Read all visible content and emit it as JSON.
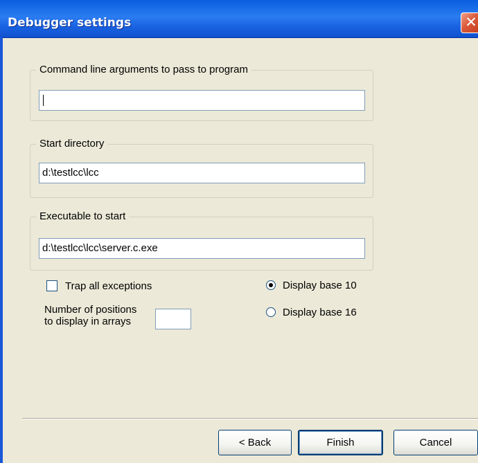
{
  "window": {
    "title": "Debugger settings",
    "close_glyph": "✕"
  },
  "groups": {
    "args": {
      "legend": "Command line arguments to pass to program",
      "value": ""
    },
    "start_dir": {
      "legend": "Start directory",
      "value": "d:\\testlcc\\lcc"
    },
    "executable": {
      "legend": "Executable to start",
      "value": "d:\\testlcc\\lcc\\server.c.exe"
    }
  },
  "options": {
    "trap_exceptions": {
      "label": "Trap all exceptions",
      "checked": false
    },
    "positions": {
      "label_line1": "Number of positions",
      "label_line2": "to display in arrays",
      "value": ""
    },
    "display_base": {
      "selected": "Display base 10",
      "options": [
        "Display base 10",
        "Display base 16"
      ]
    }
  },
  "buttons": {
    "back": "< Back",
    "finish": "Finish",
    "cancel": "Cancel"
  },
  "colors": {
    "titlebar": "#0A5EE0",
    "dialog_bg": "#ECE9D8",
    "close": "#C23A1C",
    "button_border": "#003C74"
  }
}
